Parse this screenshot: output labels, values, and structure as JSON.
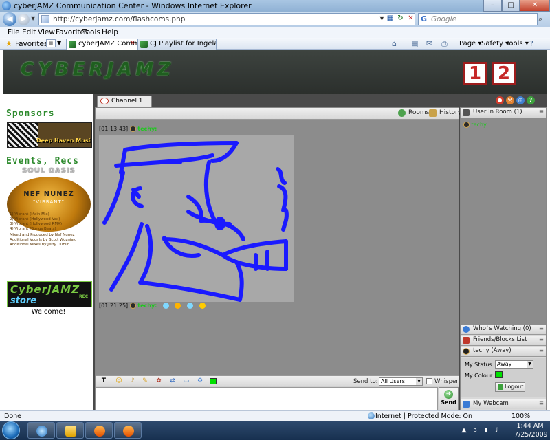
{
  "window": {
    "title": "cyberJAMZ Communication Center - Windows Internet Explorer",
    "minimize": "–",
    "maximize": "□",
    "close": "✕"
  },
  "address": {
    "url": "http://cyberjamz.com/flashcoms.php",
    "search_placeholder": "Google"
  },
  "menu": [
    "File",
    "Edit",
    "View",
    "Favorites",
    "Tools",
    "Help"
  ],
  "favorites_bar": {
    "label": "Favorites",
    "tabs": [
      "cyberJAMZ Communica...",
      "CJ Playlist for Ingela Borgef..."
    ],
    "commands": [
      "Page ▾",
      "Safety ▾",
      "Tools ▾"
    ]
  },
  "app": {
    "logo": "CYBERJAMZ",
    "numbers": [
      "1",
      "2"
    ],
    "sponsors_title": "Sponsors",
    "sponsor_text": "Deep Haven Music",
    "events_title": "Events, Recs",
    "event": {
      "brand": "SOUL OASIS",
      "artist": "NEF NUNEZ",
      "album": "\"VIBRANT\"",
      "tracks": [
        "1) Vibrant (Main Mix)",
        "2) Vibrant (Hollywood Vox)",
        "3) Vibrant (Hollywood RMX)",
        "4) Vibrant (Bonus Beats)",
        "Mixed and Produced by Nef Nunez",
        "Additional Vocals by Scott Wozniak",
        "Additional Mixes by Jerry Dublin"
      ]
    },
    "store_title": "CyberJAMZ",
    "store_rec": "REC",
    "store_sub": "store",
    "welcome": "Welcome!",
    "channel_tab": "Channel 1",
    "toolbar": {
      "rooms": "Rooms",
      "history": "History"
    },
    "messages": [
      {
        "time": "[01:13:43]",
        "user": "techy"
      },
      {
        "time": "[01:21:25]",
        "user": "techy"
      }
    ],
    "send_to_label": "Send to:",
    "send_to_value": "All Users",
    "whisper_label": "Whisper",
    "send_label": "Send",
    "panel": {
      "users_header": "User In Room (1)",
      "user_name": "techy",
      "watching_header": "Who`s Watching (0)",
      "friends_header": "Friends/Blocks List",
      "status_header": "techy (Away)",
      "my_status_label": "My Status",
      "my_status_value": "Away",
      "my_colour_label": "My Colour",
      "colour": "#00e000",
      "logout_label": "Logout",
      "webcam_header": "My Webcam"
    }
  },
  "statusbar": {
    "left": "Done",
    "zone": "Internet | Protected Mode: On",
    "zoom": "100%"
  },
  "clock": {
    "time": "1:44 AM",
    "date": "7/25/2009"
  }
}
